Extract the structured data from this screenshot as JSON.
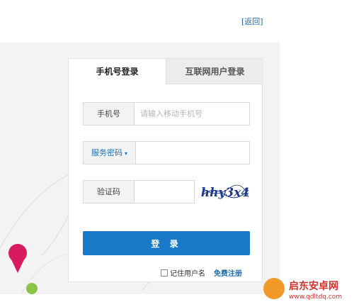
{
  "header": {
    "back_link": "[返回]"
  },
  "tabs": {
    "active": "手机号登录",
    "inactive": "互联网用户登录"
  },
  "phone": {
    "label": "手机号",
    "placeholder": "请输入移动手机号",
    "value": ""
  },
  "password": {
    "label": "服务密码",
    "caret": "▾",
    "value": ""
  },
  "captcha": {
    "label": "验证码",
    "value": "",
    "image_text": "hhy3x4"
  },
  "actions": {
    "login_label": "登 录",
    "remember_label": "记住用户名",
    "register_label": "免费注册"
  },
  "colors": {
    "primary": "#1a78c8",
    "link": "#1f6fb2",
    "accent_pink": "#d81b60",
    "accent_green": "#8bc34a"
  },
  "watermark": {
    "text": "启东安卓网",
    "url": "www.qdltdq.com"
  }
}
